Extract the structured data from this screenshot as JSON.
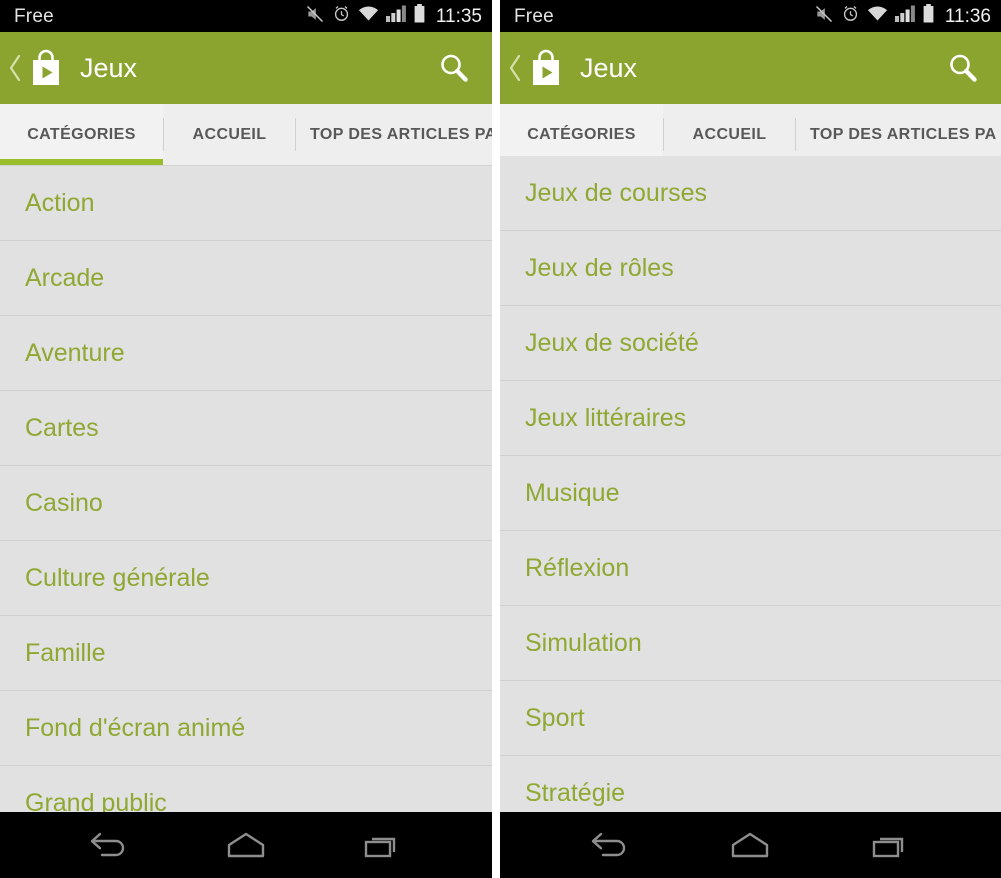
{
  "colors": {
    "action_bar_green": "#8ba32f",
    "tab_indicator_green": "#9abd2b",
    "list_text_green": "#8ea832",
    "list_background": "#e1e1e1",
    "divider": "#cfcfcf",
    "status_bar": "#000000",
    "tab_bar": "#eeeeee"
  },
  "left_screen": {
    "status": {
      "carrier": "Free",
      "time": "11:35",
      "icons": [
        "mute-icon",
        "alarm-icon",
        "wifi-icon",
        "signal-icon",
        "battery-icon"
      ]
    },
    "action_bar": {
      "back_icon": "back-chevron-icon",
      "app_icon": "play-store-bag-icon",
      "title": "Jeux",
      "search_icon": "search-icon"
    },
    "tabs": [
      {
        "label": "CATÉGORIES",
        "active": true
      },
      {
        "label": "ACCUEIL",
        "active": false
      },
      {
        "label": "TOP DES ARTICLES PA",
        "active": false
      }
    ],
    "categories": [
      "Action",
      "Arcade",
      "Aventure",
      "Cartes",
      "Casino",
      "Culture générale",
      "Famille",
      "Fond d'écran animé",
      "Grand public"
    ],
    "nav": [
      "back-nav-icon",
      "home-nav-icon",
      "recents-nav-icon"
    ]
  },
  "right_screen": {
    "status": {
      "carrier": "Free",
      "time": "11:36",
      "icons": [
        "mute-icon",
        "alarm-icon",
        "wifi-icon",
        "signal-icon",
        "battery-icon"
      ]
    },
    "action_bar": {
      "back_icon": "back-chevron-icon",
      "app_icon": "play-store-bag-icon",
      "title": "Jeux",
      "search_icon": "search-icon"
    },
    "tabs": [
      {
        "label": "CATÉGORIES",
        "active": true
      },
      {
        "label": "ACCUEIL",
        "active": false
      },
      {
        "label": "TOP DES ARTICLES PA",
        "active": false
      }
    ],
    "categories": [
      "Jeux de courses",
      "Jeux de rôles",
      "Jeux de société",
      "Jeux littéraires",
      "Musique",
      "Réflexion",
      "Simulation",
      "Sport",
      "Stratégie"
    ],
    "nav": [
      "back-nav-icon",
      "home-nav-icon",
      "recents-nav-icon"
    ]
  }
}
